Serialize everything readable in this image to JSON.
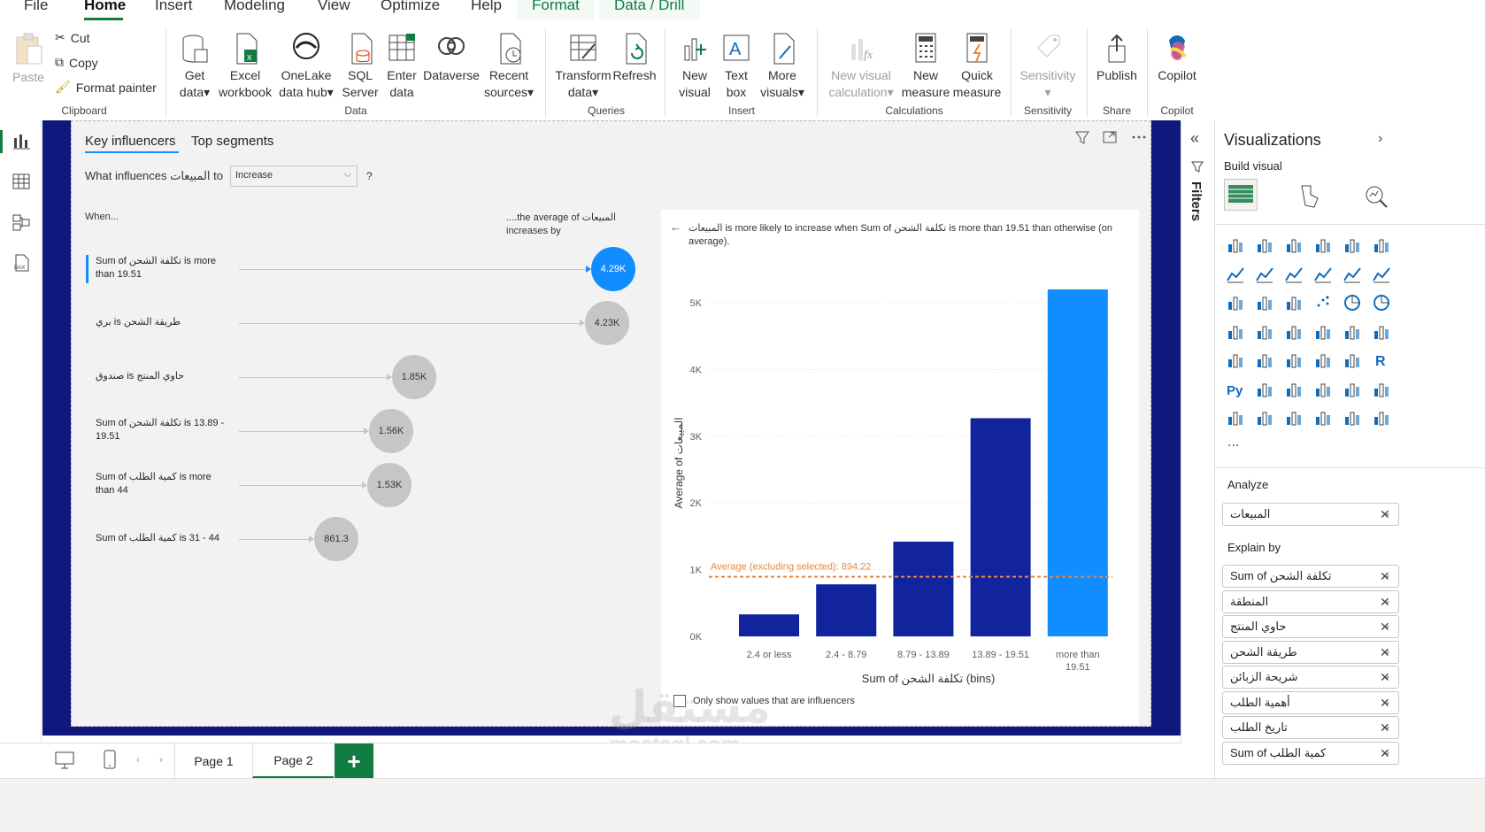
{
  "menu": {
    "items": [
      "File",
      "Home",
      "Insert",
      "Modeling",
      "View",
      "Optimize",
      "Help"
    ],
    "context_items": [
      "Format",
      "Data / Drill"
    ],
    "active": "Home"
  },
  "ribbon": {
    "clipboard": {
      "paste": "Paste",
      "cut": "Cut",
      "copy": "Copy",
      "format_painter": "Format painter",
      "label": "Clipboard"
    },
    "data": {
      "get_data": [
        "Get",
        "data"
      ],
      "excel": [
        "Excel",
        "workbook"
      ],
      "onelake": [
        "OneLake",
        "data hub"
      ],
      "sql": [
        "SQL",
        "Server"
      ],
      "enter": [
        "Enter",
        "data"
      ],
      "dataverse": "Dataverse",
      "recent": [
        "Recent",
        "sources"
      ],
      "label": "Data"
    },
    "queries": {
      "transform": [
        "Transform",
        "data"
      ],
      "refresh": "Refresh",
      "label": "Queries"
    },
    "insert": {
      "new_visual": [
        "New",
        "visual"
      ],
      "text_box": [
        "Text",
        "box"
      ],
      "more_visuals": [
        "More",
        "visuals"
      ],
      "label": "Insert"
    },
    "calculations": {
      "new_visual_calc": [
        "New visual",
        "calculation"
      ],
      "new_measure": [
        "New",
        "measure"
      ],
      "quick_measure": [
        "Quick",
        "measure"
      ],
      "label": "Calculations"
    },
    "sensitivity": {
      "btn": "Sensitivity",
      "label": "Sensitivity"
    },
    "share": {
      "publish": "Publish",
      "label": "Share"
    },
    "copilot": {
      "btn": "Copilot",
      "label": "Copilot"
    }
  },
  "visual": {
    "tabs": [
      "Key influencers",
      "Top segments"
    ],
    "question_prefix": "What influences المبيعات to",
    "dropdown_value": "Increase",
    "question_mark": "?",
    "when_label": "When...",
    "avg_label": "....the average of المبيعات increases by",
    "influencers": [
      {
        "label": "Sum of تكلفة الشحن is more than 19.51",
        "value": "4.29K",
        "selected": true
      },
      {
        "label": "بري is طريقة الشحن",
        "value": "4.23K",
        "selected": false
      },
      {
        "label": "صندوق is حاوي المنتج",
        "value": "1.85K",
        "selected": false
      },
      {
        "label": "Sum of تكلفة الشحن is 13.89 - 19.51",
        "value": "1.56K",
        "selected": false
      },
      {
        "label": "Sum of كمية الطلب is more than 44",
        "value": "1.53K",
        "selected": false
      },
      {
        "label": "Sum of كمية الطلب is 31 - 44",
        "value": "861.3",
        "selected": false
      }
    ],
    "detail_text": "المبيعات is more likely to increase when Sum of تكلفة الشحن is more than 19.51 than otherwise (on average).",
    "checkbox_label": "Only show values that are influencers"
  },
  "chart_data": {
    "type": "bar",
    "categories": [
      "2.4 or less",
      "2.4 - 8.79",
      "8.79 - 13.89",
      "13.89 - 19.51",
      "more than 19.51"
    ],
    "values": [
      330,
      780,
      1420,
      3270,
      5200
    ],
    "highlight_index": 4,
    "colors": {
      "base": "#12239e",
      "highlight": "#118dff",
      "avg_line": "#e8883a"
    },
    "xlabel": "Sum of تكلفة الشحن (bins)",
    "ylabel": "Average of المبيعات",
    "yticks": [
      "0K",
      "1K",
      "2K",
      "3K",
      "4K",
      "5K"
    ],
    "ylim": [
      0,
      5000
    ],
    "average_line": {
      "value": 894.22,
      "label": "Average (excluding selected): 894.22"
    }
  },
  "pages": [
    "Page 1",
    "Page 2"
  ],
  "active_page": "Page 2",
  "filters_label": "Filters",
  "viz_pane": {
    "title": "Visualizations",
    "build_visual": "Build visual",
    "more": "...",
    "analyze_label": "Analyze",
    "analyze_field": "المبيعات",
    "explain_label": "Explain by",
    "explain_fields": [
      "Sum of تكلفة الشحن",
      "المنطقة",
      "حاوي المنتج",
      "طريقة الشحن",
      "شريحة الزبائن",
      "أهمية الطلب",
      "تاريخ الطلب",
      "Sum of كمية الطلب"
    ]
  },
  "watermark": {
    "arabic": "مستقل",
    "latin": "mostaql.com"
  }
}
